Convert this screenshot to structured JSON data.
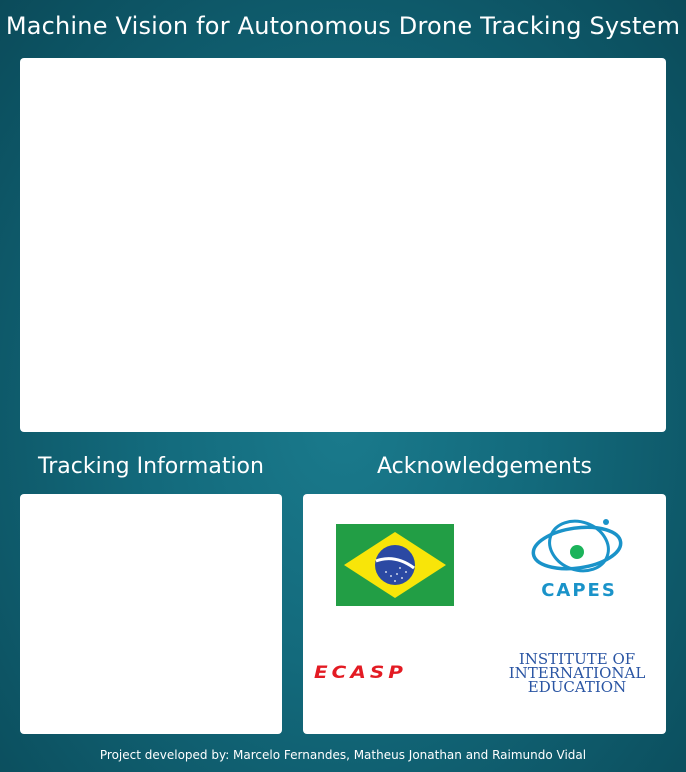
{
  "header": {
    "title": "Machine Vision for Autonomous Drone Tracking System"
  },
  "sections": {
    "tracking_title": "Tracking Information",
    "acknowledgements_title": "Acknowledgements"
  },
  "acknowledgements": {
    "logos": [
      {
        "icon": "brazil-flag-icon"
      },
      {
        "icon": "capes-logo-icon",
        "text": "CAPES"
      },
      {
        "icon": "ecasp-logo-icon",
        "text": "ECASP"
      },
      {
        "icon": "iie-logo-icon",
        "lines": [
          "INSTITUTE OF",
          "INTERNATIONAL",
          "EDUCATION"
        ]
      }
    ]
  },
  "colors": {
    "background": "#136a7c",
    "panel": "#ffffff",
    "capes_blue": "#1a93c9",
    "ecasp_red": "#e31b23",
    "iie_blue": "#2a55a3",
    "flag_green": "#229e45",
    "flag_yellow": "#f8e509",
    "flag_blue": "#2b49a3"
  },
  "footer": {
    "credits": "Project developed by: Marcelo Fernandes, Matheus Jonathan and Raimundo Vidal"
  }
}
